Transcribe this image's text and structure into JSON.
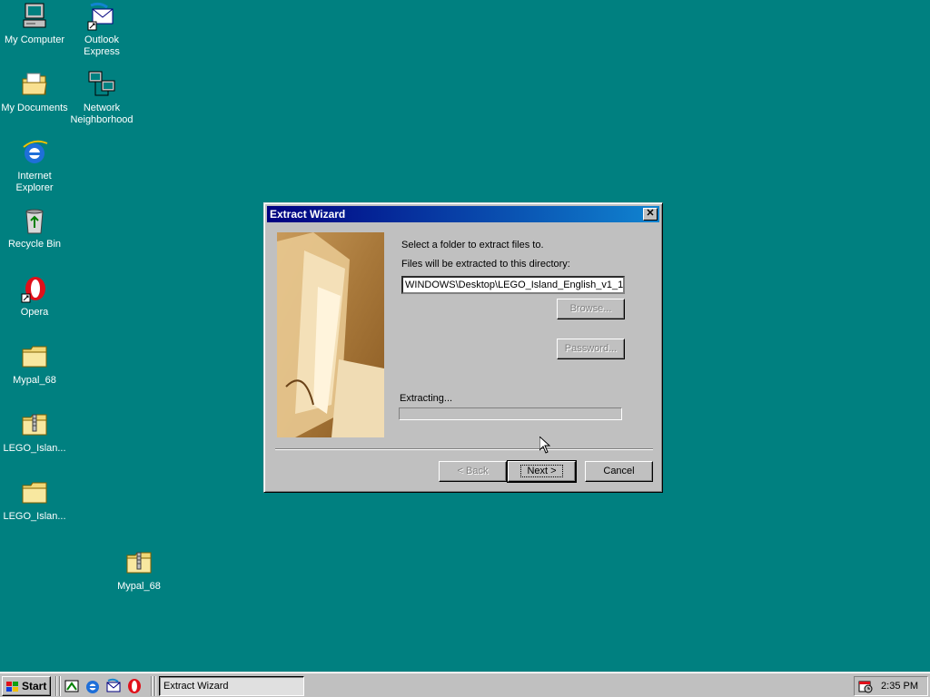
{
  "desktop": {
    "icons": [
      {
        "label": "My Computer",
        "icon": "computer-icon"
      },
      {
        "label": "Outlook Express",
        "icon": "outlook-express-icon"
      },
      {
        "label": "My Documents",
        "icon": "documents-folder-icon"
      },
      {
        "label": "Network Neighborhood",
        "icon": "network-icon"
      },
      {
        "label": "Internet Explorer",
        "icon": "internet-explorer-icon"
      },
      {
        "label": "Recycle Bin",
        "icon": "recycle-bin-icon"
      },
      {
        "label": "Opera",
        "icon": "opera-icon"
      },
      {
        "label": "Mypal_68",
        "icon": "folder-icon"
      },
      {
        "label": "LEGO_Islan...",
        "icon": "zip-folder-icon"
      },
      {
        "label": "LEGO_Islan...",
        "icon": "folder-icon"
      },
      {
        "label": "Mypal_68",
        "icon": "zip-folder-icon"
      }
    ]
  },
  "dialog": {
    "title": "Extract Wizard",
    "close_glyph": "✕",
    "instruction": "Select a folder to extract files to.",
    "directory_label": "Files will be extracted to this directory:",
    "directory_value": "WINDOWS\\Desktop\\LEGO_Island_English_v1_1",
    "browse_label": "Browse...",
    "password_label": "Password...",
    "status_text": "Extracting...",
    "progress": 0,
    "back_label": "< Back",
    "next_label": "Next >",
    "cancel_label": "Cancel"
  },
  "taskbar": {
    "start_label": "Start",
    "quick_launch": [
      "show-desktop-icon",
      "internet-explorer-icon",
      "outlook-express-icon",
      "opera-icon"
    ],
    "task_label": "Extract Wizard",
    "clock": "2:35 PM"
  }
}
